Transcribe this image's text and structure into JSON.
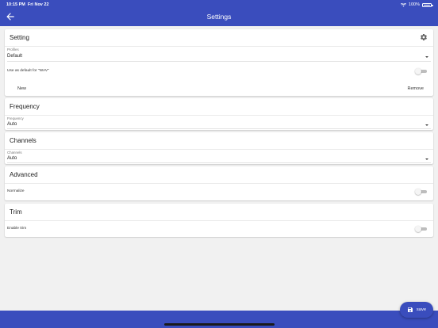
{
  "status_bar": {
    "time": "10:15 PM",
    "date": "Fri Nov 22",
    "battery": "100%"
  },
  "appbar": {
    "title": "Settings"
  },
  "setting": {
    "title": "Setting",
    "profiles_label": "Profiles",
    "profiles_value": "Default",
    "default_label": "Use as default for \"WAV\"",
    "default_on": false,
    "new_label": "New",
    "remove_label": "Remove"
  },
  "frequency": {
    "title": "Frequency",
    "field_label": "Frequency",
    "field_value": "Auto"
  },
  "channels": {
    "title": "Channels",
    "field_label": "Channels",
    "field_value": "Auto"
  },
  "advanced": {
    "title": "Advanced",
    "normalize_label": "Normalize",
    "normalize_on": false
  },
  "trim": {
    "title": "Trim",
    "enable_label": "Enable trim",
    "enable_on": false
  },
  "fab": {
    "label": "save"
  },
  "colors": {
    "primary": "#3a4dbd",
    "background": "#f1f1f1"
  }
}
